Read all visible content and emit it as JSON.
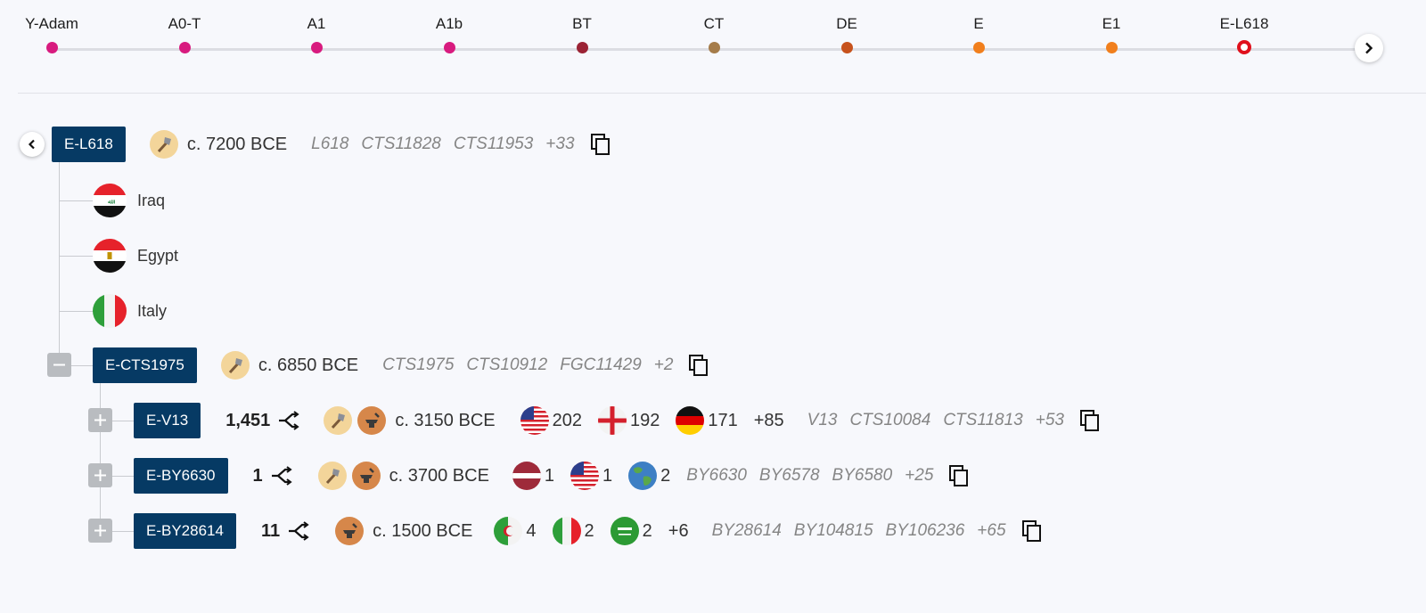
{
  "lineage": [
    {
      "label": "Y-Adam",
      "color": "#d81b7f"
    },
    {
      "label": "A0-T",
      "color": "#d81b7f"
    },
    {
      "label": "A1",
      "color": "#d81b7f"
    },
    {
      "label": "A1b",
      "color": "#d81b7f"
    },
    {
      "label": "BT",
      "color": "#9b2335"
    },
    {
      "label": "CT",
      "color": "#a57c4a"
    },
    {
      "label": "DE",
      "color": "#c7521c"
    },
    {
      "label": "E",
      "color": "#f17f1d"
    },
    {
      "label": "E1",
      "color": "#f17f1d"
    },
    {
      "label": "E-L618",
      "color": "#e0101c",
      "current": true
    }
  ],
  "root": {
    "name": "E-L618",
    "age": "c. 7200 BCE",
    "snps": [
      "L618",
      "CTS11828",
      "CTS11953",
      "+33"
    ]
  },
  "countries": [
    {
      "name": "Iraq"
    },
    {
      "name": "Egypt"
    },
    {
      "name": "Italy"
    }
  ],
  "child": {
    "name": "E-CTS1975",
    "age": "c. 6850 BCE",
    "snps": [
      "CTS1975",
      "CTS10912",
      "FGC11429",
      "+2"
    ]
  },
  "subclades": [
    {
      "name": "E-V13",
      "count": "1,451",
      "age": "c. 3150 BCE",
      "countries": [
        {
          "flag": "usa-flag",
          "value": "202"
        },
        {
          "flag": "england-flag",
          "value": "192"
        },
        {
          "flag": "germany-flag",
          "value": "171"
        }
      ],
      "more": "+85",
      "snps": [
        "V13",
        "CTS10084",
        "CTS11813",
        "+53"
      ]
    },
    {
      "name": "E-BY6630",
      "count": "1",
      "age": "c. 3700 BCE",
      "countries": [
        {
          "flag": "latvia-flag",
          "value": "1"
        },
        {
          "flag": "usa-flag",
          "value": "1"
        },
        {
          "flag": "globe-icon",
          "value": "2"
        }
      ],
      "more": "",
      "snps": [
        "BY6630",
        "BY6578",
        "BY6580",
        "+25"
      ]
    },
    {
      "name": "E-BY28614",
      "count": "11",
      "age": "c. 1500 BCE",
      "countries": [
        {
          "flag": "algeria-flag",
          "value": "4"
        },
        {
          "flag": "italy-flag",
          "value": "2"
        },
        {
          "flag": "saudi-flag",
          "value": "2"
        }
      ],
      "more": "+6",
      "snps": [
        "BY28614",
        "BY104815",
        "BY106236",
        "+65"
      ]
    }
  ]
}
